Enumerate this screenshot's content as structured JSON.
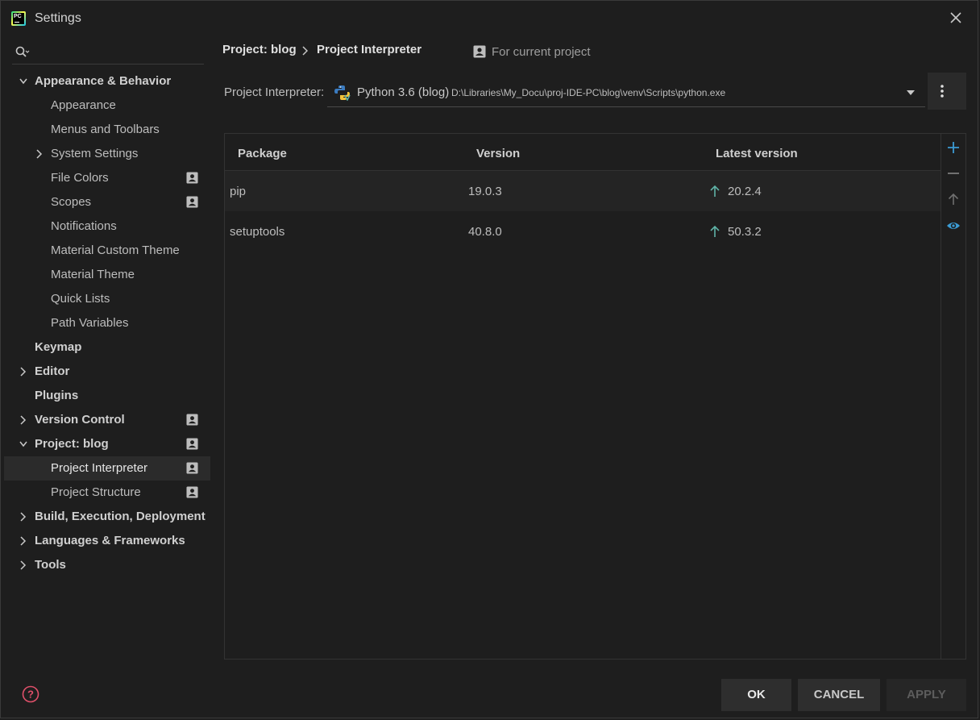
{
  "window": {
    "title": "Settings"
  },
  "search": {
    "placeholder": ""
  },
  "sidebar": {
    "items": [
      {
        "label": "Appearance & Behavior",
        "level": 0,
        "bold": true,
        "expanded": true,
        "has_chevron": true,
        "project_scoped": false,
        "selected": false
      },
      {
        "label": "Appearance",
        "level": 1,
        "bold": false,
        "has_chevron": false,
        "project_scoped": false,
        "selected": false
      },
      {
        "label": "Menus and Toolbars",
        "level": 1,
        "bold": false,
        "has_chevron": false,
        "project_scoped": false,
        "selected": false
      },
      {
        "label": "System Settings",
        "level": 1,
        "bold": false,
        "has_chevron": true,
        "expanded": false,
        "project_scoped": false,
        "selected": false
      },
      {
        "label": "File Colors",
        "level": 1,
        "bold": false,
        "has_chevron": false,
        "project_scoped": true,
        "selected": false
      },
      {
        "label": "Scopes",
        "level": 1,
        "bold": false,
        "has_chevron": false,
        "project_scoped": true,
        "selected": false
      },
      {
        "label": "Notifications",
        "level": 1,
        "bold": false,
        "has_chevron": false,
        "project_scoped": false,
        "selected": false
      },
      {
        "label": "Material Custom Theme",
        "level": 1,
        "bold": false,
        "has_chevron": false,
        "project_scoped": false,
        "selected": false
      },
      {
        "label": "Material Theme",
        "level": 1,
        "bold": false,
        "has_chevron": false,
        "project_scoped": false,
        "selected": false
      },
      {
        "label": "Quick Lists",
        "level": 1,
        "bold": false,
        "has_chevron": false,
        "project_scoped": false,
        "selected": false
      },
      {
        "label": "Path Variables",
        "level": 1,
        "bold": false,
        "has_chevron": false,
        "project_scoped": false,
        "selected": false
      },
      {
        "label": "Keymap",
        "level": 0,
        "bold": true,
        "has_chevron": false,
        "project_scoped": false,
        "selected": false
      },
      {
        "label": "Editor",
        "level": 0,
        "bold": true,
        "has_chevron": true,
        "expanded": false,
        "project_scoped": false,
        "selected": false
      },
      {
        "label": "Plugins",
        "level": 0,
        "bold": true,
        "has_chevron": false,
        "project_scoped": false,
        "selected": false
      },
      {
        "label": "Version Control",
        "level": 0,
        "bold": true,
        "has_chevron": true,
        "expanded": false,
        "project_scoped": true,
        "selected": false
      },
      {
        "label": "Project: blog",
        "level": 0,
        "bold": true,
        "has_chevron": true,
        "expanded": true,
        "project_scoped": true,
        "selected": false
      },
      {
        "label": "Project Interpreter",
        "level": 1,
        "bold": false,
        "has_chevron": false,
        "project_scoped": true,
        "selected": true
      },
      {
        "label": "Project Structure",
        "level": 1,
        "bold": false,
        "has_chevron": false,
        "project_scoped": true,
        "selected": false
      },
      {
        "label": "Build, Execution, Deployment",
        "level": 0,
        "bold": true,
        "has_chevron": true,
        "expanded": false,
        "project_scoped": false,
        "selected": false
      },
      {
        "label": "Languages & Frameworks",
        "level": 0,
        "bold": true,
        "has_chevron": true,
        "expanded": false,
        "project_scoped": false,
        "selected": false
      },
      {
        "label": "Tools",
        "level": 0,
        "bold": true,
        "has_chevron": true,
        "expanded": false,
        "project_scoped": false,
        "selected": false
      }
    ]
  },
  "breadcrumb": {
    "parent": "Project: blog",
    "current": "Project Interpreter"
  },
  "scope": {
    "label": "For current project"
  },
  "interpreter": {
    "label": "Project Interpreter:",
    "name": "Python 3.6 (blog)",
    "path": "D:\\Libraries\\My_Docu\\proj-IDE-PC\\blog\\venv\\Scripts\\python.exe"
  },
  "packages": {
    "columns": [
      "Package",
      "Version",
      "Latest version"
    ],
    "rows": [
      {
        "package": "pip",
        "version": "19.0.3",
        "latest": "20.2.4"
      },
      {
        "package": "setuptools",
        "version": "40.8.0",
        "latest": "50.3.2"
      }
    ]
  },
  "buttons": {
    "ok": "OK",
    "cancel": "CANCEL",
    "apply": "APPLY"
  },
  "colors": {
    "background": "#1e1e1e",
    "accent_blue": "#3b9bd4",
    "upgrade_arrow": "#5fb3a7",
    "help_red": "#e0506a"
  }
}
